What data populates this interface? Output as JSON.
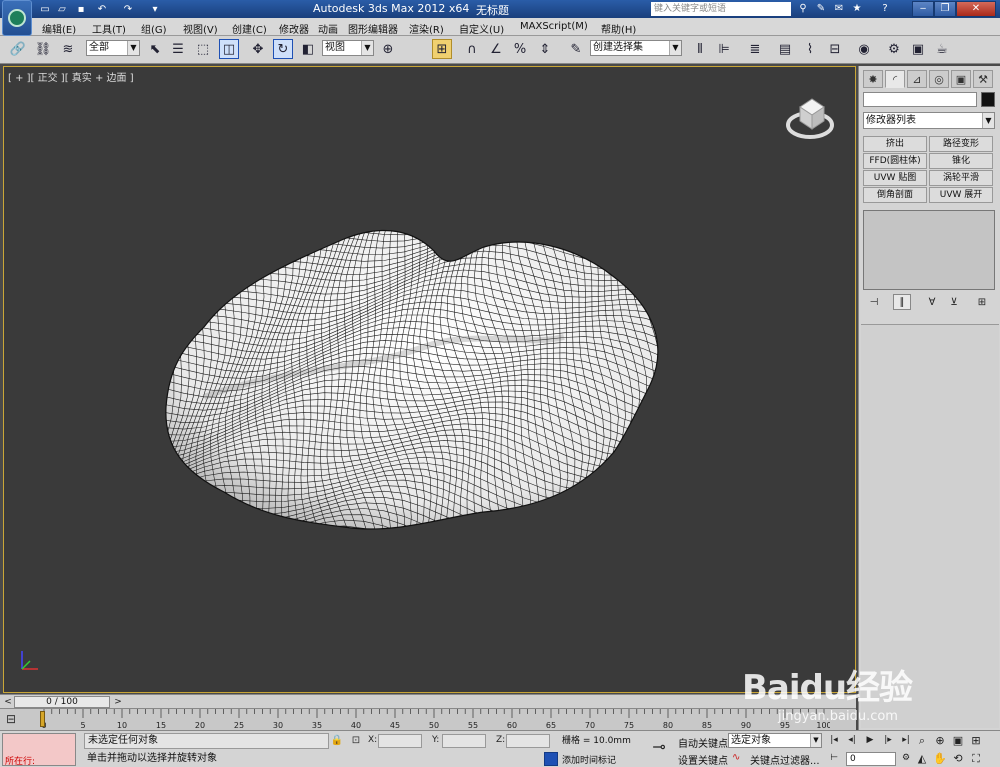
{
  "titlebar": {
    "app_title": "Autodesk 3ds Max  2012 x64",
    "document": "无标题",
    "search_placeholder": "键入关键字或短语"
  },
  "menubar": {
    "items": [
      "编辑(E)",
      "工具(T)",
      "组(G)",
      "视图(V)",
      "创建(C)",
      "修改器",
      "动画",
      "图形编辑器",
      "渲染(R)",
      "自定义(U)",
      "MAXScript(M)",
      "帮助(H)"
    ]
  },
  "toolbar": {
    "selection_filter": "全部",
    "reference_coord": "视图",
    "named_selection": "创建选择集"
  },
  "viewport": {
    "label": "[ + ][ 正交 ][ 真实 + 边面 ]"
  },
  "command_panel": {
    "modifier_list": "修改器列表",
    "modifier_buttons": [
      "挤出",
      "路径变形",
      "FFD(圆柱体)",
      "锥化",
      "UVW 贴图",
      "涡轮平滑",
      "倒角剖面",
      "UVW 展开"
    ]
  },
  "time_slider": {
    "position": "0 / 100",
    "current_frame": 0,
    "total_frames": 100
  },
  "track_bar": {
    "tick_labels": [
      "0",
      "5",
      "10",
      "15",
      "20",
      "25",
      "30",
      "35",
      "40",
      "45",
      "50",
      "55",
      "60",
      "65",
      "70",
      "75",
      "80",
      "85",
      "90",
      "95",
      "100"
    ]
  },
  "status": {
    "maxscript_label": "所在行:",
    "selection_status": "未选定任何对象",
    "prompt": "单击并拖动以选择并旋转对象",
    "x_label": "X:",
    "y_label": "Y:",
    "z_label": "Z:",
    "grid": "栅格 = 10.0mm",
    "add_time_tag": "添加时间标记",
    "auto_key": "自动关键点",
    "set_key": "设置关键点",
    "selection_mode": "选定对象",
    "key_filters": "关键点过滤器...",
    "frame_value": "0"
  },
  "watermark": {
    "brand": "Baidu经验",
    "url": "jingyan.baidu.com"
  }
}
